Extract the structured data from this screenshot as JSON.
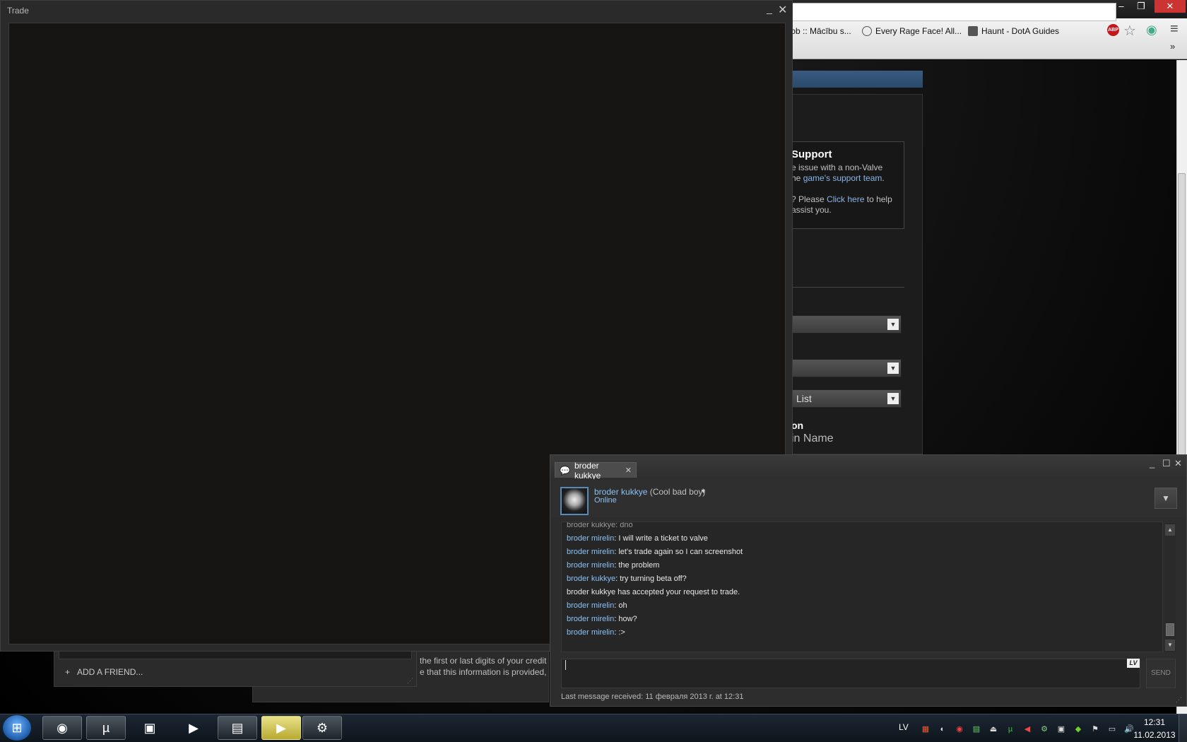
{
  "browser": {
    "bookmarks": [
      {
        "label": "ɔb :: Mācību s..."
      },
      {
        "label": "Every Rage Face! All..."
      },
      {
        "label": "Haunt - DotA Guides"
      }
    ],
    "window_controls": {
      "minimize": "–",
      "restore": "❐",
      "close": "✕"
    },
    "abp_label": "ABP"
  },
  "support_page": {
    "title": "Support",
    "line1": "e issue with a non-Valve",
    "line2_prefix": "he ",
    "line2_link": "game's support team",
    "line2_suffix": ".",
    "line3_prefix": "? Please ",
    "line3_link": "Click here",
    "line3_suffix": " to help",
    "line4": " assist you.",
    "select1_value": "",
    "select2_value": "",
    "select3_value": "List",
    "section_title": "on",
    "field_label": "in Name"
  },
  "background_dialog": {
    "line1": "the first or last digits of your credit",
    "line2": "e that this information is provided,"
  },
  "friends_list": {
    "add_friend_icon": "+",
    "add_friend_label": "ADD A FRIEND..."
  },
  "trade": {
    "title": "Trade",
    "minimize": "_",
    "close": "✕"
  },
  "chat": {
    "tab_label": "broder kukkye",
    "friend_name": "broder kukkye",
    "friend_nickname": " (Cool bad boy)",
    "friend_status": "Online",
    "messages": [
      {
        "who": "broder kukkye",
        "text": ": dno",
        "faded": true
      },
      {
        "who": "broder mirelin",
        "text": ": I will write a ticket to valve"
      },
      {
        "who": "broder mirelin",
        "text": ": let's trade again so I can screenshot"
      },
      {
        "who": "broder mirelin",
        "text": ": the problem"
      },
      {
        "who": "broder kukkye",
        "text": ": try turning beta off?"
      },
      {
        "who": "",
        "text": "broder kukkye has accepted your request to trade."
      },
      {
        "who": "broder mirelin",
        "text": ": oh"
      },
      {
        "who": "broder mirelin",
        "text": ": how?"
      },
      {
        "who": "broder mirelin",
        "text": ": :>"
      }
    ],
    "input_value": "",
    "keyboard_lang": "LV",
    "send_label": "SEND",
    "last_message": "Last message received: 11 февраля 2013 г. at 12:31"
  },
  "taskbar": {
    "apps": [
      {
        "name": "chrome-icon",
        "glyph": "◉"
      },
      {
        "name": "utorrent-icon",
        "glyph": "µ"
      },
      {
        "name": "app-icon",
        "glyph": "▣"
      },
      {
        "name": "media-player-icon",
        "glyph": "▶"
      },
      {
        "name": "explorer-icon",
        "glyph": "▤"
      },
      {
        "name": "video-editor-icon",
        "glyph": "▶"
      },
      {
        "name": "steam-icon",
        "glyph": "⚙"
      }
    ],
    "language": "LV",
    "clock_time": "12:31",
    "clock_date": "11.02.2013"
  }
}
